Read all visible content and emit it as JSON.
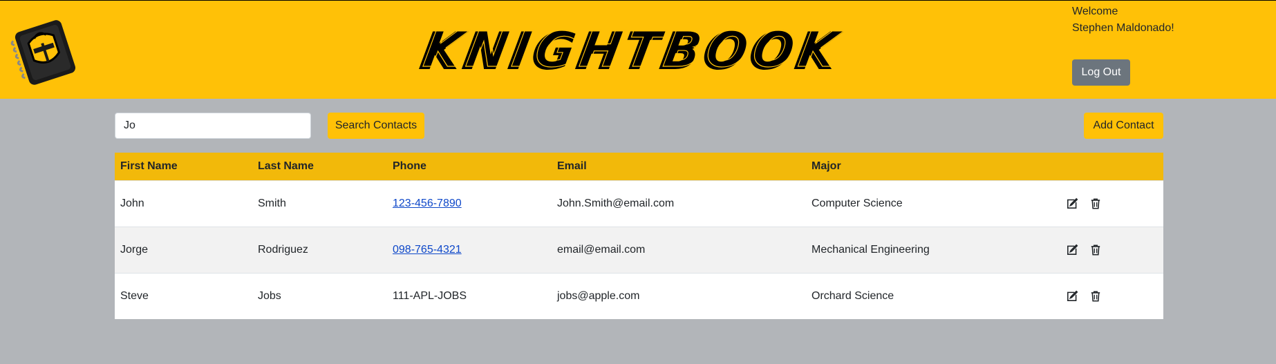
{
  "header": {
    "brand": "KNIGHTBOOK",
    "welcome_line1": "Welcome",
    "welcome_line2": "Stephen Maldonado!",
    "logout_label": "Log Out"
  },
  "toolbar": {
    "search_value": "Jo",
    "search_button": "Search Contacts",
    "add_button": "Add Contact"
  },
  "table": {
    "columns": [
      "First Name",
      "Last Name",
      "Phone",
      "Email",
      "Major"
    ],
    "rows": [
      {
        "first": "John",
        "last": "Smith",
        "phone": "123-456-7890",
        "phone_link": true,
        "email": "John.Smith@email.com",
        "major": "Computer Science"
      },
      {
        "first": "Jorge",
        "last": "Rodriguez",
        "phone": "098-765-4321",
        "phone_link": true,
        "email": "email@email.com",
        "major": "Mechanical Engineering"
      },
      {
        "first": "Steve",
        "last": "Jobs",
        "phone": "111-APL-JOBS",
        "phone_link": false,
        "email": "jobs@apple.com",
        "major": "Orchard Science"
      }
    ]
  },
  "colors": {
    "header_bg": "#ffc107",
    "page_bg": "#b2b5b9",
    "table_header_bg": "#f2b90a",
    "link": "#0d47c9",
    "logout_bg": "#6c757d"
  },
  "icons": {
    "logo": "knight-notebook-logo-icon",
    "edit": "edit-icon",
    "delete": "trash-icon"
  }
}
